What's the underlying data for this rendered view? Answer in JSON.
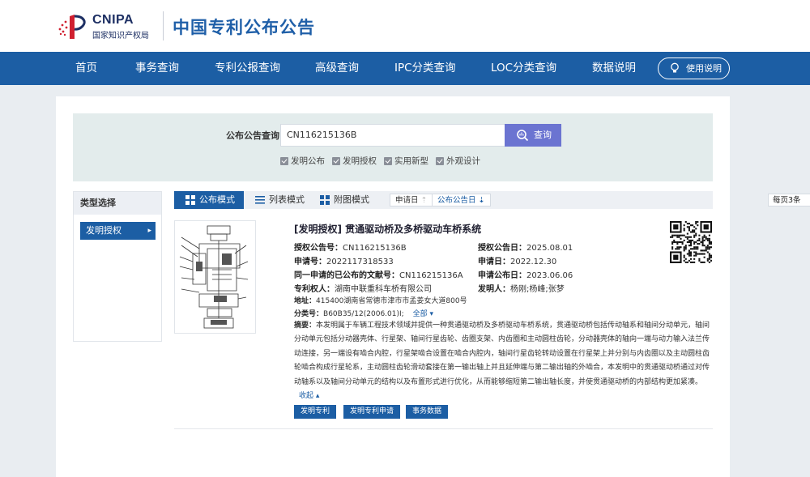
{
  "header": {
    "logo_en": "CNIPA",
    "logo_zh": "国家知识产权局",
    "site_title": "中国专利公布公告"
  },
  "nav": {
    "items": [
      "首页",
      "事务查询",
      "专利公报查询",
      "高级查询",
      "IPC分类查询",
      "LOC分类查询",
      "数据说明"
    ],
    "help_label": "使用说明"
  },
  "search": {
    "label": "公布公告查询",
    "value": "CN116215136B",
    "button_label": "查询",
    "checkboxes": [
      {
        "label": "发明公布",
        "checked": true
      },
      {
        "label": "发明授权",
        "checked": true
      },
      {
        "label": "实用新型",
        "checked": true
      },
      {
        "label": "外观设计",
        "checked": true
      }
    ]
  },
  "sidebar": {
    "title": "类型选择",
    "items": [
      "发明授权"
    ]
  },
  "toolbar": {
    "tabs": [
      "公布模式",
      "列表模式",
      "附图模式"
    ],
    "sort_apply": "申请日",
    "sort_pub": "公布公告日",
    "per_page": "每页3条"
  },
  "result": {
    "title": "[发明授权] 贯通驱动桥及多桥驱动车桥系统",
    "grant_no_label": "授权公告号：",
    "grant_no": "CN116215136B",
    "grant_date_label": "授权公告日：",
    "grant_date": "2025.08.01",
    "app_no_label": "申请号：",
    "app_no": "2022117318533",
    "app_date_label": "申请日：",
    "app_date": "2022.12.30",
    "same_app_label": "同一申请的已公布的文献号：",
    "same_app": "CN116215136A",
    "pub_date_label": "申请公布日：",
    "pub_date": "2023.06.06",
    "holder_label": "专利权人：",
    "holder": "湖南中联重科车桥有限公司",
    "inventor_label": "发明人：",
    "inventor": "杨刚;杨峰;张梦",
    "address_label": "地址：",
    "address": "415400湖南省常德市津市市孟姜女大道800号",
    "class_label": "分类号：",
    "class_no": "B60B35/12(2006.01)I;",
    "class_all": "全部",
    "abstract_label": "摘要：",
    "abstract_lines": [
      "本发明属于车辆工程技术领域并提供一种贯通驱动桥及多桥驱动车桥系统，贯通驱动桥包括传动轴系和轴间分动单元，轴间",
      "分动单元包括分动器壳体、行星架、轴间行星齿轮、齿圈支架、内齿圈和主动圆柱齿轮，分动器壳体的轴向一端与动力输入法兰传",
      "动连接，另一端设有啮合内腔，行星架啮合设置在啮合内腔内，轴间行星齿轮转动设置在行星架上并分别与内齿圈以及主动圆柱齿",
      "轮啮合构成行星轮系，主动圆柱齿轮滑动套接在第一输出轴上并且延伸端与第二输出轴的外啮合，本发明中的贯通驱动桥通过对传",
      "动轴系以及轴间分动单元的结构以及布置形式进行优化，从而能够缩短第二输出轴长度，并使贯通驱动桥的内部结构更加紧凑。"
    ],
    "collapse": "收起",
    "buttons": [
      "发明专利",
      "发明专利申请",
      "事务数据"
    ]
  },
  "colors": {
    "nav_blue": "#1c5ea4",
    "search_button": "#6b74d1",
    "search_bg": "#e3ecec"
  }
}
